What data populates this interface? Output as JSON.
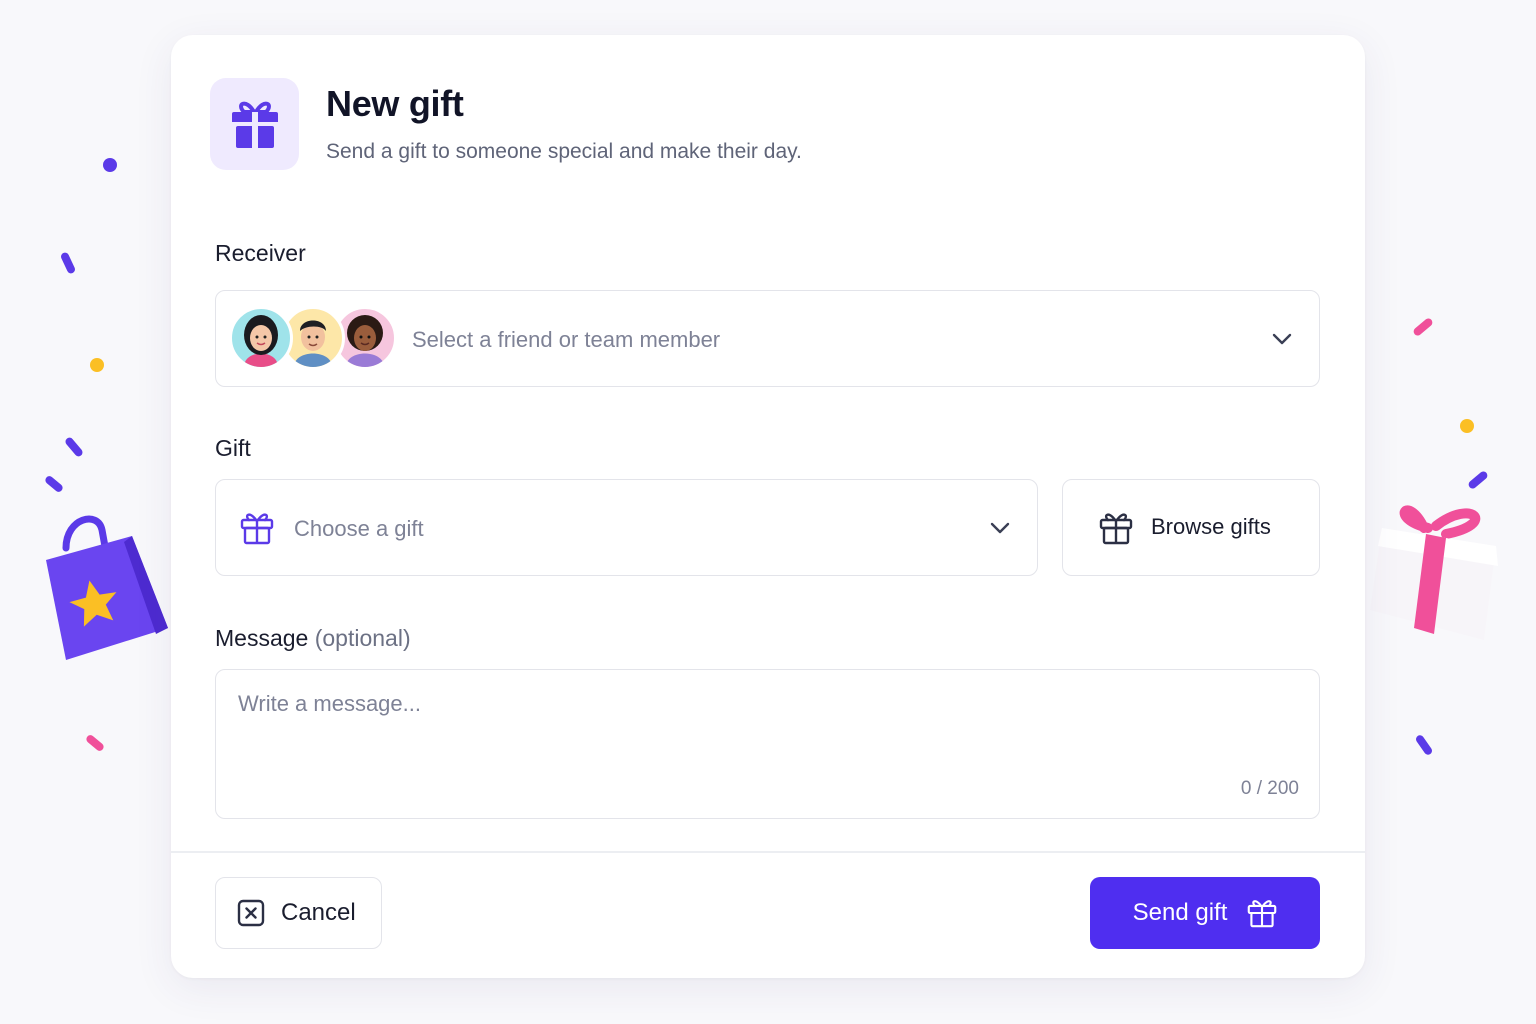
{
  "dialog": {
    "title": "New gift",
    "subtitle": "Send a gift to someone special and make their day."
  },
  "receiver": {
    "label": "Receiver",
    "placeholder": "Select a friend or team member"
  },
  "gift": {
    "label": "Gift",
    "placeholder": "Choose a gift",
    "browse_label": "Browse gifts"
  },
  "message": {
    "label": "Message",
    "optional": "(optional)",
    "placeholder": "Write a message...",
    "counter": "0 / 200"
  },
  "actions": {
    "cancel_label": "Cancel",
    "send_label": "Send gift"
  },
  "colors": {
    "accent": "#4f2ef0",
    "accent_soft": "#efeafe",
    "gold": "#fbbf24",
    "pink": "#f0509a"
  }
}
